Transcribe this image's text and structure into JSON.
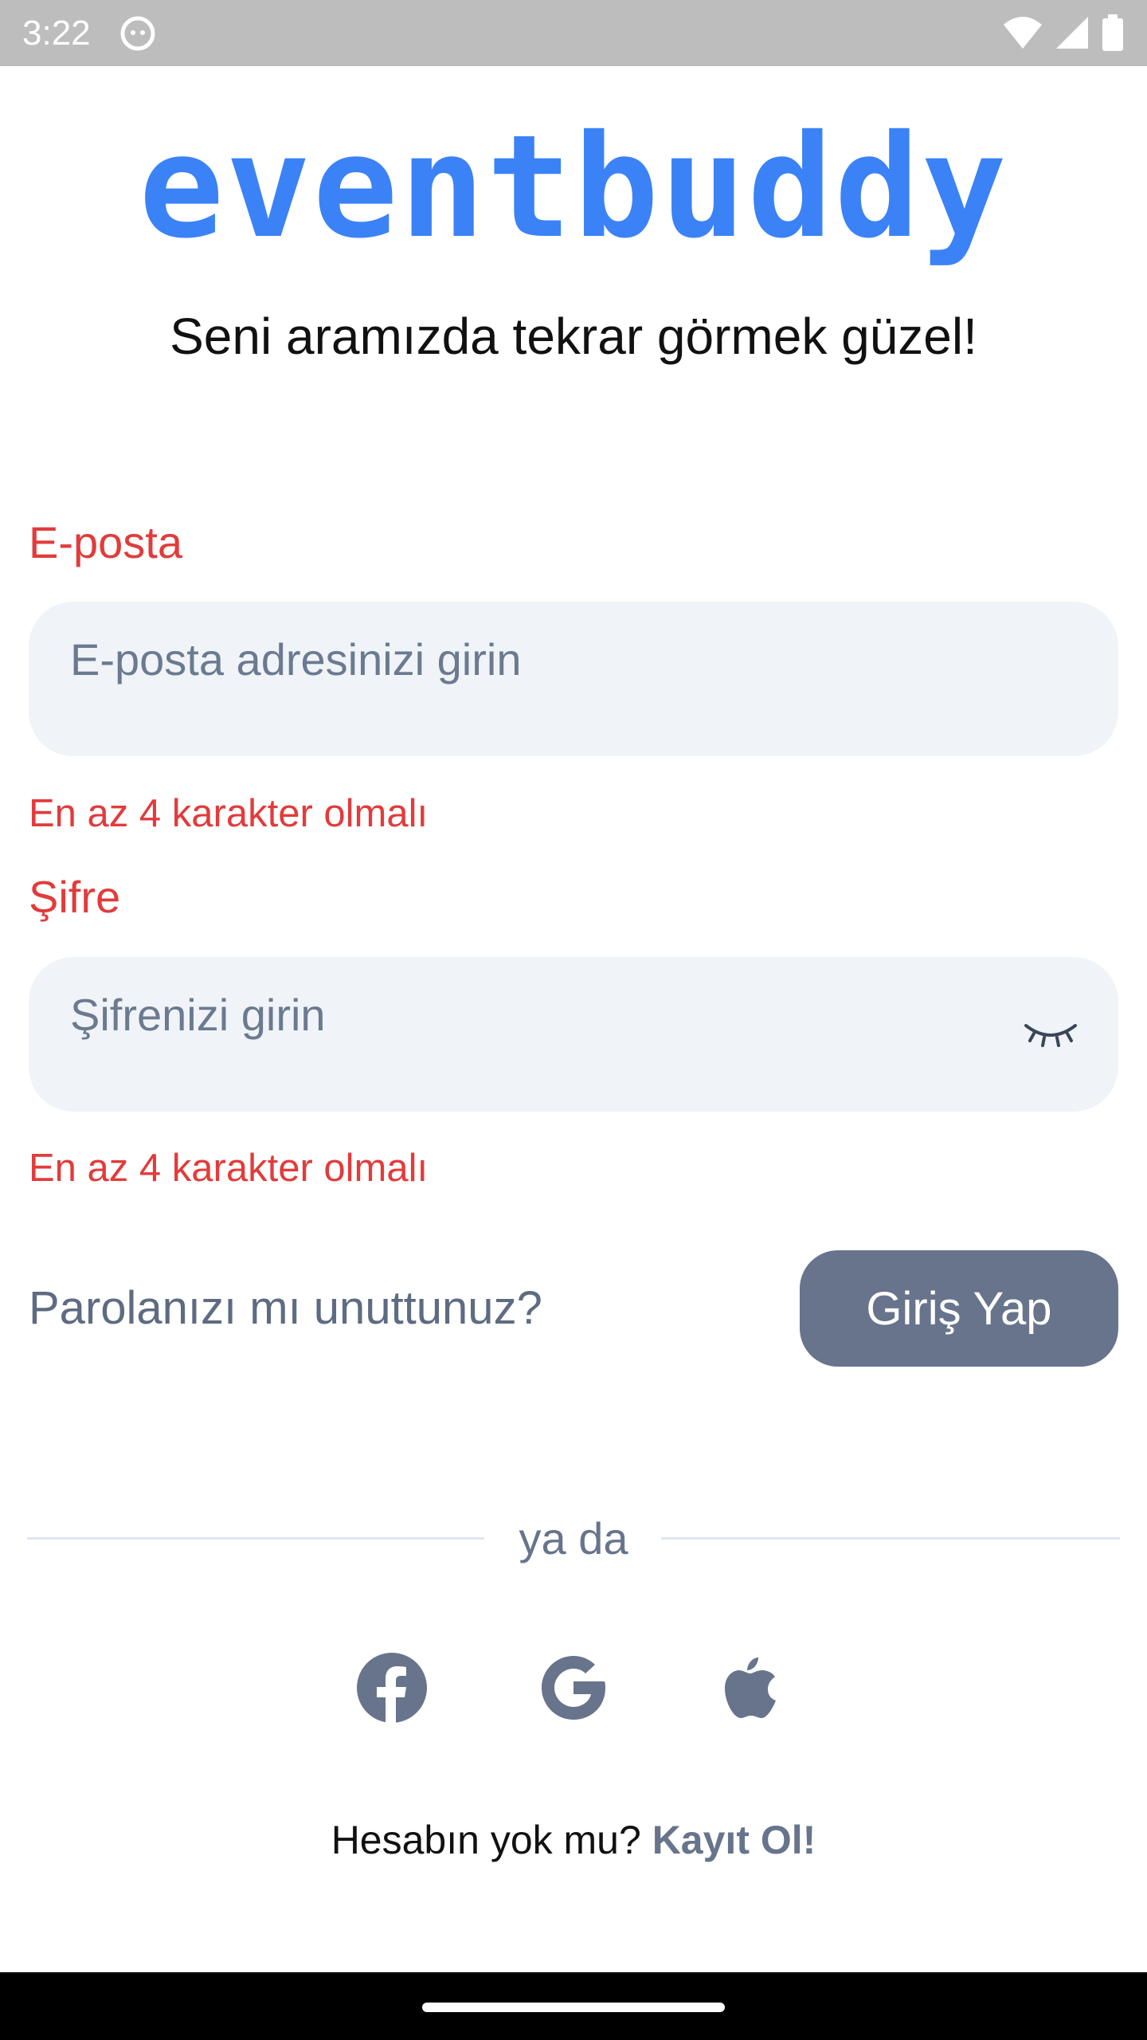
{
  "status_bar": {
    "time": "3:22"
  },
  "app": {
    "logo": "eventbuddy",
    "brand_color": "#3b82f6"
  },
  "header": {
    "subtitle": "Seni aramızda tekrar görmek güzel!"
  },
  "form": {
    "email": {
      "label": "E-posta",
      "placeholder": "E-posta adresinizi girin",
      "value": "",
      "error": "En az 4 karakter olmalı"
    },
    "password": {
      "label": "Şifre",
      "placeholder": "Şifrenizi girin",
      "value": "",
      "error": "En az 4 karakter olmalı"
    },
    "forgot_password": "Parolanızı mı unuttunuz?",
    "login_button": "Giriş Yap"
  },
  "divider": {
    "text": "ya da"
  },
  "social": {
    "icons": [
      "facebook-icon",
      "google-icon",
      "apple-icon"
    ]
  },
  "footer": {
    "prompt": "Hesabın yok mu?",
    "signup_link": "Kayıt Ol!"
  },
  "colors": {
    "error": "#e23b3b",
    "muted": "#67748c",
    "input_bg": "#f0f4f9"
  }
}
